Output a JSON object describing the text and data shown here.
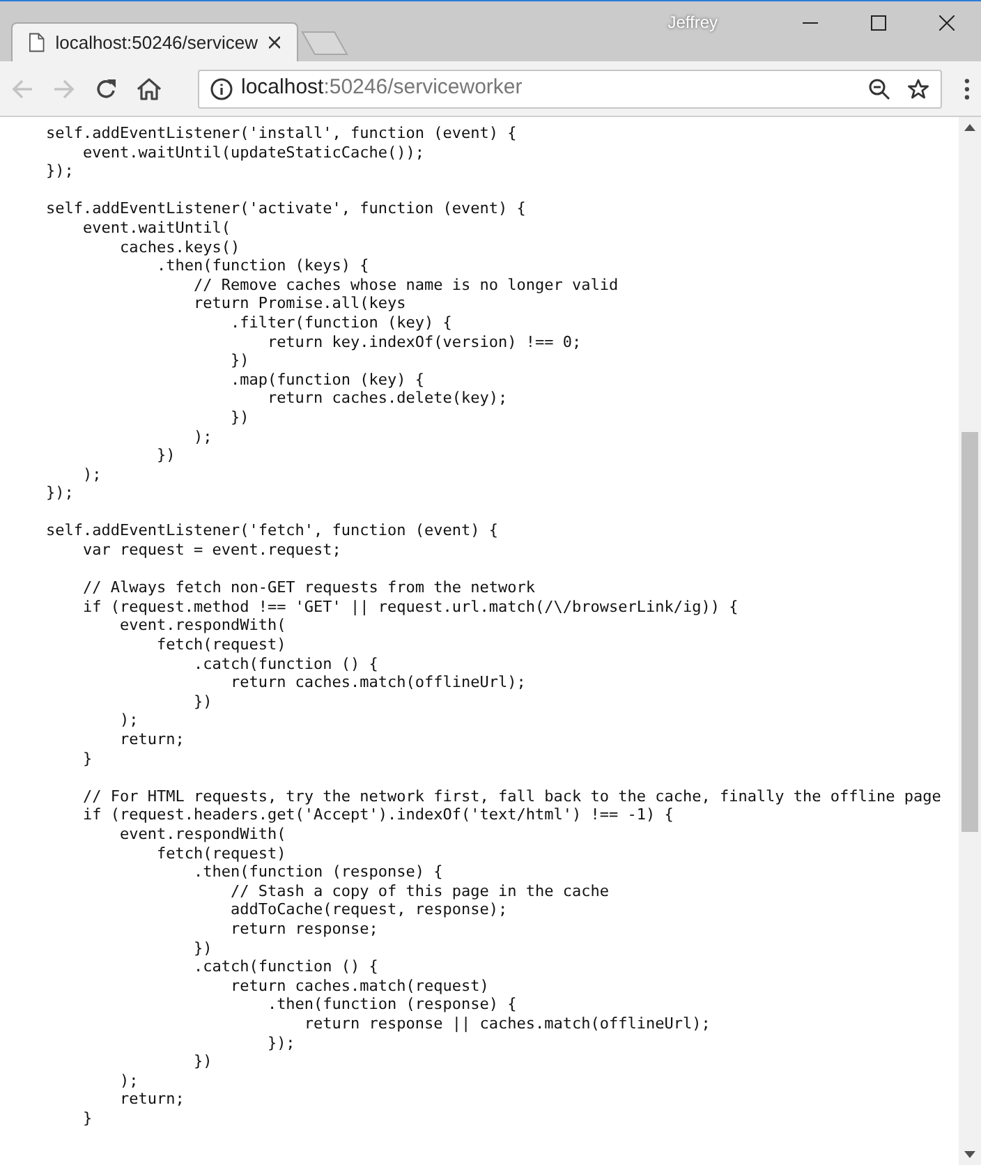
{
  "window": {
    "profile_name": "Jeffrey"
  },
  "tabs": [
    {
      "title": "localhost:50246/servicew",
      "selected": true
    }
  ],
  "nav_buttons": [
    {
      "kind": "back",
      "disabled": true
    },
    {
      "kind": "forward",
      "disabled": true
    },
    {
      "kind": "reload",
      "disabled": false
    },
    {
      "kind": "home",
      "disabled": false
    }
  ],
  "address_bar": {
    "host": "localhost",
    "path": ":50246/serviceworker"
  },
  "code_blocks": [
    [
      "self.addEventListener('install', function (event) {",
      "    event.waitUntil(updateStaticCache());",
      "});"
    ],
    [
      "self.addEventListener('activate', function (event) {",
      "    event.waitUntil(",
      "        caches.keys()",
      "            .then(function (keys) {",
      "                // Remove caches whose name is no longer valid",
      "                return Promise.all(keys",
      "                    .filter(function (key) {",
      "                        return key.indexOf(version) !== 0;",
      "                    })",
      "                    .map(function (key) {",
      "                        return caches.delete(key);",
      "                    })",
      "                );",
      "            })",
      "    );",
      "});"
    ],
    [
      "self.addEventListener('fetch', function (event) {",
      "    var request = event.request;"
    ],
    [
      "    // Always fetch non-GET requests from the network",
      "    if (request.method !== 'GET' || request.url.match(/\\/browserLink/ig)) {",
      "        event.respondWith(",
      "            fetch(request)",
      "                .catch(function () {",
      "                    return caches.match(offlineUrl);",
      "                })",
      "        );",
      "        return;",
      "    }"
    ],
    [
      "    // For HTML requests, try the network first, fall back to the cache, finally the offline page",
      "    if (request.headers.get('Accept').indexOf('text/html') !== -1) {",
      "        event.respondWith(",
      "            fetch(request)",
      "                .then(function (response) {",
      "                    // Stash a copy of this page in the cache",
      "                    addToCache(request, response);",
      "                    return response;",
      "                })",
      "                .catch(function () {",
      "                    return caches.match(request)",
      "                        .then(function (response) {",
      "                            return response || caches.match(offlineUrl);",
      "                        });",
      "                })",
      "        );",
      "        return;",
      "    }"
    ]
  ]
}
